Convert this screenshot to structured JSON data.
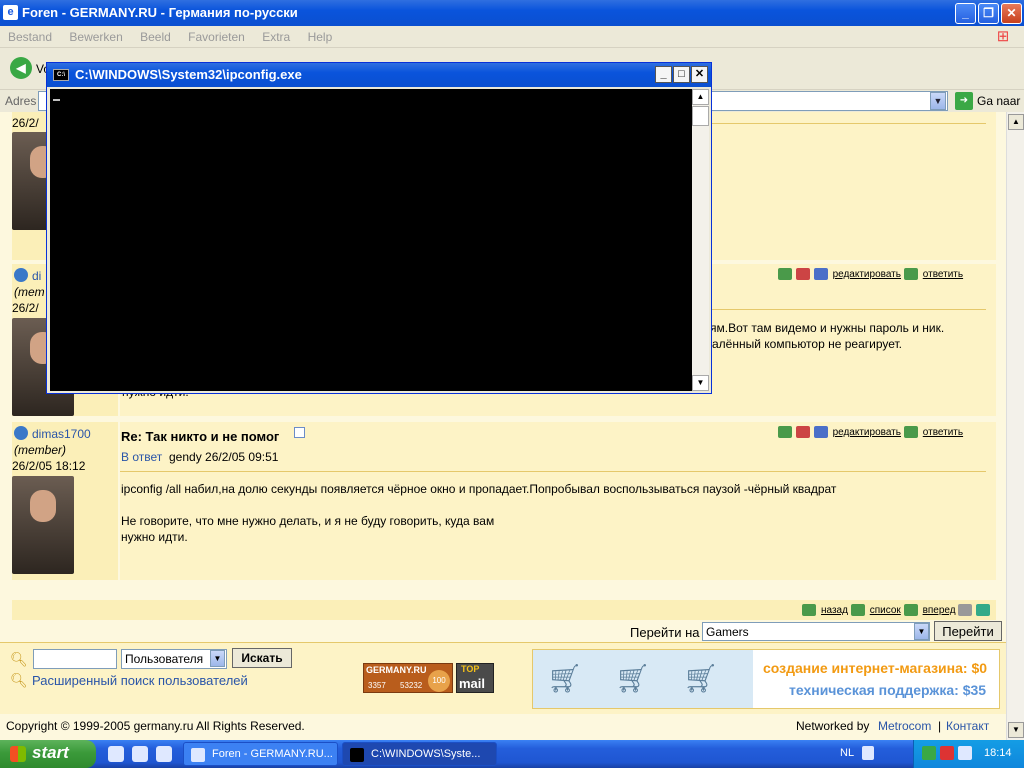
{
  "window": {
    "title": "Foren - GERMANY.RU - Германия по-русски"
  },
  "menu": [
    "Bestand",
    "Bewerken",
    "Beeld",
    "Favorieten",
    "Extra",
    "Help"
  ],
  "toolbar": {
    "back_label": "Vorige"
  },
  "address": {
    "label": "Adres",
    "go_label": "Ga naar"
  },
  "console": {
    "title": "C:\\WINDOWS\\System32\\ipconfig.exe"
  },
  "posts": [
    {
      "date_fragment": "26/2/"
    },
    {
      "user_fragment": "di",
      "role": "(mem",
      "date_fragment": "26/2/",
      "visible_lines": [
        "ям.Вот там видемо и нужны пароль и ник.",
        "алённый компьютор не реагирует."
      ],
      "tail": "нужно идти."
    },
    {
      "user": "dimas1700",
      "role": "(member)",
      "date": "26/2/05 18:12",
      "title": "Re: Так никто и не помог",
      "reply_link": "В ответ",
      "reply_info": "gendy 26/2/05 09:51",
      "text1": "ipconfig /all набил,на долю секунды появляется чёрное окно и пропадает.Попробывал воспользываться паузой -чёрный квадрат",
      "text2": "Не говорите, что мне нужно делать, и я не буду говорить, куда вам",
      "text3": "нужно идти."
    }
  ],
  "post_actions": {
    "edit": "редактировать",
    "reply": "ответить"
  },
  "nav": {
    "back": "назад",
    "list": "список",
    "forward": "вперед"
  },
  "jump": {
    "label": "Перейти на",
    "selected": "Gamers",
    "button": "Перейти"
  },
  "search": {
    "select": "Пользователя",
    "button": "Искать",
    "advanced": "Расширенный поиск пользователей"
  },
  "counter": {
    "site": "GERMANY.RU",
    "a": "3357",
    "b": "53232",
    "top": "TOP",
    "hundred": "100",
    "mail": "mail"
  },
  "banner": {
    "line1": "создание интернет-магазина: $0",
    "line2": "техническая поддержка: $35"
  },
  "footer": {
    "copyright": "Copyright © 1999-2005 germany.ru All Rights Reserved.",
    "networked": "Networked by",
    "metrocom": "Metrocom",
    "sep": "|",
    "contact": "Контакт"
  },
  "taskbar": {
    "start": "start",
    "task1": "Foren - GERMANY.RU...",
    "task2": "C:\\WINDOWS\\Syste...",
    "lang": "NL",
    "time": "18:14"
  },
  "colors": {
    "accent": "#0a54dc",
    "content_bg": "#fdf8de",
    "post_bg": "#fdf3c6",
    "user_bg": "#fbefb8",
    "link": "#2a55a8"
  }
}
